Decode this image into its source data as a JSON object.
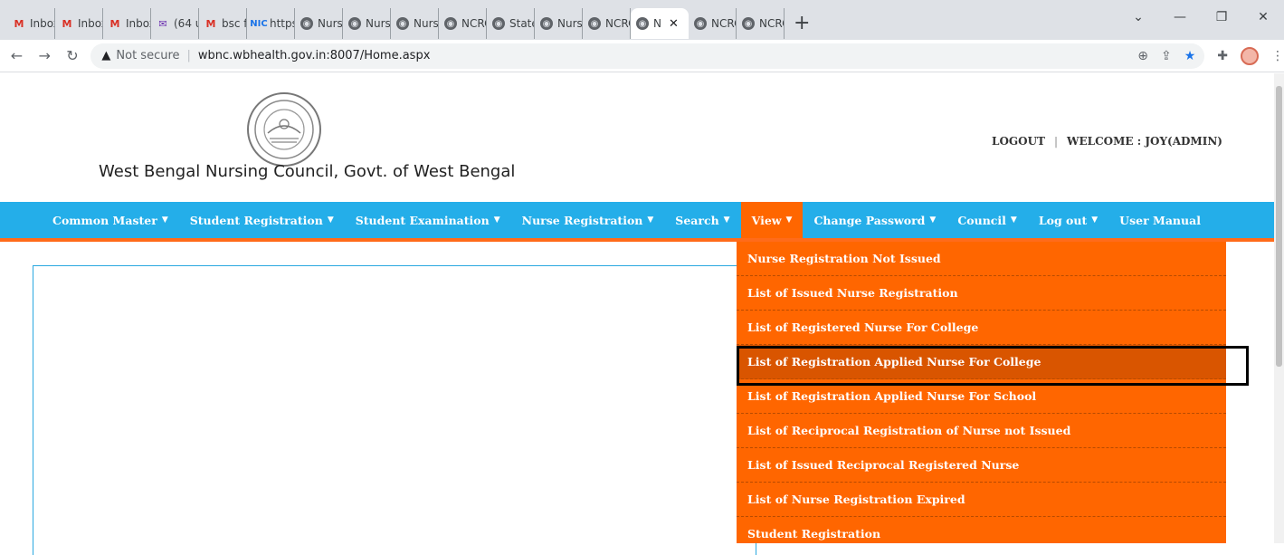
{
  "browser": {
    "tabs": [
      {
        "label": "Inbox",
        "icon": "gmail-icon"
      },
      {
        "label": "Inbox",
        "icon": "gmail-icon"
      },
      {
        "label": "Inbox",
        "icon": "gmail-icon"
      },
      {
        "label": "(64 u",
        "icon": "mail-icon"
      },
      {
        "label": "bsc fi",
        "icon": "gmail-icon"
      },
      {
        "label": "https:",
        "icon": "nic-icon"
      },
      {
        "label": "Nursi",
        "icon": "globe-icon"
      },
      {
        "label": "Nursi",
        "icon": "globe-icon"
      },
      {
        "label": "Nursi",
        "icon": "globe-icon"
      },
      {
        "label": "NCRC",
        "icon": "globe-icon"
      },
      {
        "label": "State",
        "icon": "globe-icon"
      },
      {
        "label": "Nursi",
        "icon": "globe-icon"
      },
      {
        "label": "NCRC",
        "icon": "globe-icon"
      },
      {
        "label": "N",
        "icon": "globe-icon",
        "active": true
      },
      {
        "label": "NCRC",
        "icon": "globe-icon"
      },
      {
        "label": "NCRC",
        "icon": "globe-icon"
      }
    ],
    "new_tab": "+",
    "security_label": "Not secure",
    "url": "wbnc.wbhealth.gov.in:8007/Home.aspx"
  },
  "header": {
    "org_title": "West Bengal Nursing Council, Govt. of West Bengal",
    "logout": "LOGOUT",
    "welcome": "WELCOME : JOY(ADMIN)"
  },
  "navbar": {
    "items": [
      {
        "label": "Common Master",
        "caret": true
      },
      {
        "label": "Student Registration",
        "caret": true
      },
      {
        "label": "Student Examination",
        "caret": true
      },
      {
        "label": "Nurse Registration",
        "caret": true
      },
      {
        "label": "Search",
        "caret": true
      },
      {
        "label": "View",
        "caret": true,
        "active": true
      },
      {
        "label": "Change Password",
        "caret": true
      },
      {
        "label": "Council",
        "caret": true
      },
      {
        "label": "Log out",
        "caret": true
      },
      {
        "label": "User Manual",
        "caret": false
      }
    ]
  },
  "view_menu": {
    "items": [
      "Nurse Registration Not Issued",
      "List of Issued Nurse Registration",
      "List of Registered Nurse For College",
      "List of Registration Applied Nurse For College",
      "List of Registration Applied Nurse For School",
      "List of Reciprocal Registration of Nurse not Issued",
      "List of Issued Reciprocal Registered Nurse",
      "List of Nurse Registration Expired",
      "Student Registration"
    ],
    "highlighted_index": 3
  },
  "colors": {
    "navbar": "#24aee9",
    "accent": "#ff6600",
    "highlight_border": "#000000"
  }
}
